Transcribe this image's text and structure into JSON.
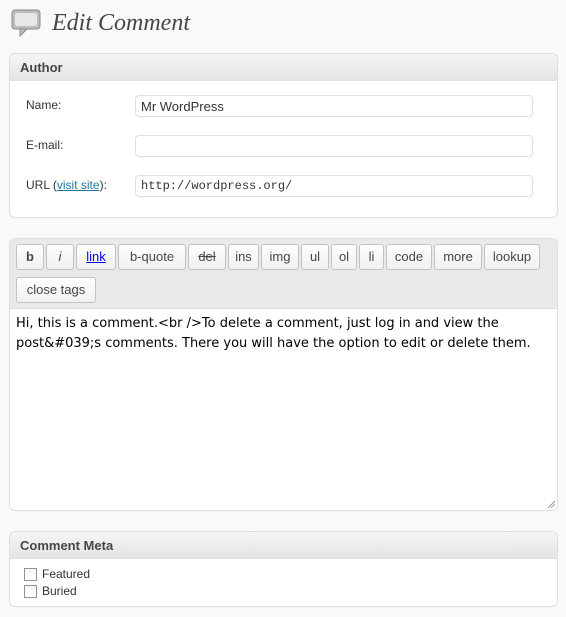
{
  "page": {
    "title": "Edit Comment",
    "icon": "comment-bubble-icon"
  },
  "author": {
    "header": "Author",
    "name_label": "Name:",
    "name_value": "Mr WordPress",
    "email_label": "E-mail:",
    "email_value": "",
    "url_label_prefix": "URL (",
    "url_link": "visit site",
    "url_label_suffix": "):",
    "url_value": "http://wordpress.org/"
  },
  "editor": {
    "buttons": [
      "b",
      "i",
      "link",
      "b-quote",
      "del",
      "ins",
      "img",
      "ul",
      "ol",
      "li",
      "code",
      "more",
      "lookup",
      "close tags"
    ],
    "content": "Hi, this is a comment.<br />To delete a comment, just log in and view the post&#039;s comments. There you will have the option to edit or delete them."
  },
  "meta": {
    "header": "Comment Meta",
    "options": [
      {
        "label": "Featured",
        "checked": false
      },
      {
        "label": "Buried",
        "checked": false
      }
    ]
  },
  "colors": {
    "link": "#21759b",
    "header_bg": "#e9e9e9",
    "border": "#dfdfdf"
  }
}
